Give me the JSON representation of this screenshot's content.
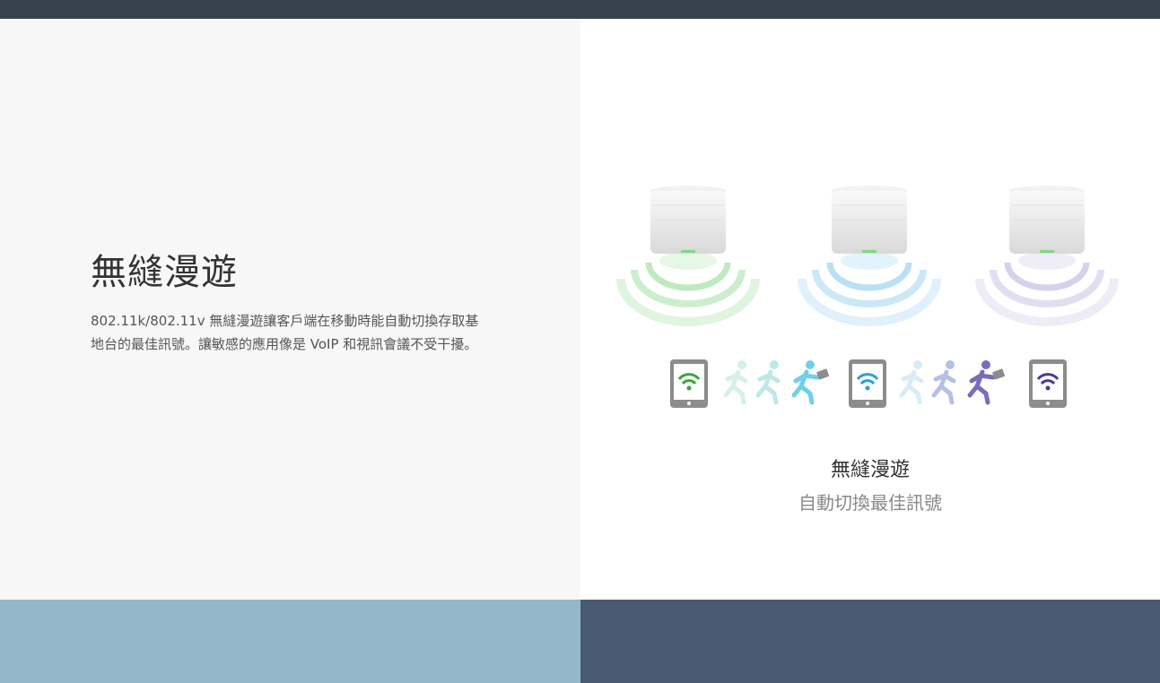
{
  "header": {},
  "left": {
    "title": "無縫漫遊",
    "description": "802.11k/802.11v 無縫漫遊讓客戶端在移動時能自動切換存取基地台的最佳訊號。讓敏感的應用像是 VoIP 和視訊會議不受干擾。"
  },
  "right": {
    "title": "無縫漫遊",
    "subtitle": "自動切換最佳訊號",
    "access_points": [
      {
        "icon": "access-point-icon",
        "signal_color": "#7fd87f"
      },
      {
        "icon": "access-point-icon",
        "signal_color": "#7cc6ee"
      },
      {
        "icon": "access-point-icon",
        "signal_color": "#b7b0e0"
      }
    ],
    "tablets": [
      {
        "icon": "tablet-wifi-icon",
        "wifi_color": "#3aa63a"
      },
      {
        "icon": "tablet-wifi-icon",
        "wifi_color": "#2a9fd8"
      },
      {
        "icon": "tablet-wifi-icon",
        "wifi_color": "#4b3b8f"
      }
    ],
    "runner_colors": [
      "#6fd0e8",
      "#7b6cb8"
    ]
  },
  "colors": {
    "top_bar": "#38424f",
    "left_bg": "#f7f7f7",
    "bottom_left": "#93b8c7",
    "bottom_right": "#4a5a71"
  }
}
